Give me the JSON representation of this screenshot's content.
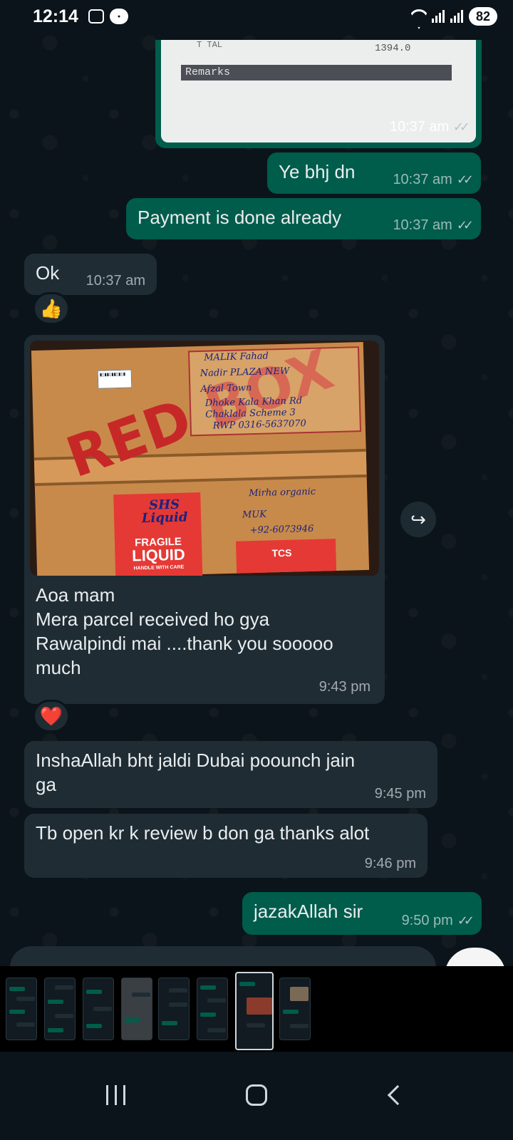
{
  "status_bar": {
    "time": "12:14",
    "battery": "82"
  },
  "receipt_image": {
    "title_fragment": "T TAL",
    "amount": "1394.0",
    "remarks_label": "Remarks",
    "time": "10:37 am"
  },
  "messages": [
    {
      "text": "Ye bhj dn",
      "time": "10:37 am",
      "direction": "outgoing"
    },
    {
      "text": "Payment is done already",
      "time": "10:37 am",
      "direction": "outgoing"
    },
    {
      "text": "Ok",
      "time": "10:37 am",
      "direction": "incoming",
      "reaction": "👍"
    },
    {
      "text": "InshaAllah bht jaldi Dubai poounch jain\nga",
      "time": "9:45 pm",
      "direction": "incoming"
    },
    {
      "text": "Tb open kr k review b don ga thanks alot",
      "time": "9:46 pm",
      "direction": "incoming"
    },
    {
      "text": "jazakAllah sir",
      "time": "9:50 pm",
      "direction": "outgoing"
    }
  ],
  "parcel_message": {
    "caption": "Aoa mam\nMera  parcel received ho gya\nRawalpindi mai ....thank you sooooo\nmuch",
    "time": "9:43 pm",
    "reaction": "❤️",
    "photo_text": {
      "brand": "RED BOX",
      "fragile_1": "FRAGILE",
      "fragile_2": "LIQUID",
      "fragile_3": "HANDLE WITH CARE",
      "handwriting_1": "MALIK Fahad",
      "handwriting_2": "Nadir PLAZA NEW",
      "handwriting_3": "Afzal Town",
      "handwriting_4": "Dhoke Kala Khan Rd",
      "handwriting_5": "Chaklala Scheme 3",
      "handwriting_6": "RWP 0316-5637070",
      "handwriting_7": "Mirha organic",
      "handwriting_8": "MUK",
      "handwriting_9": "+92-6073946",
      "handwriting_10": "SHS Liquid",
      "tcs": "TCS"
    }
  },
  "icons": {
    "forward": "forward-icon",
    "double_tick": "double-tick-icon"
  },
  "colors": {
    "background": "#0b141a",
    "outgoing_bubble": "#005c4b",
    "incoming_bubble": "#1f2c34",
    "text": "#e9edef"
  }
}
